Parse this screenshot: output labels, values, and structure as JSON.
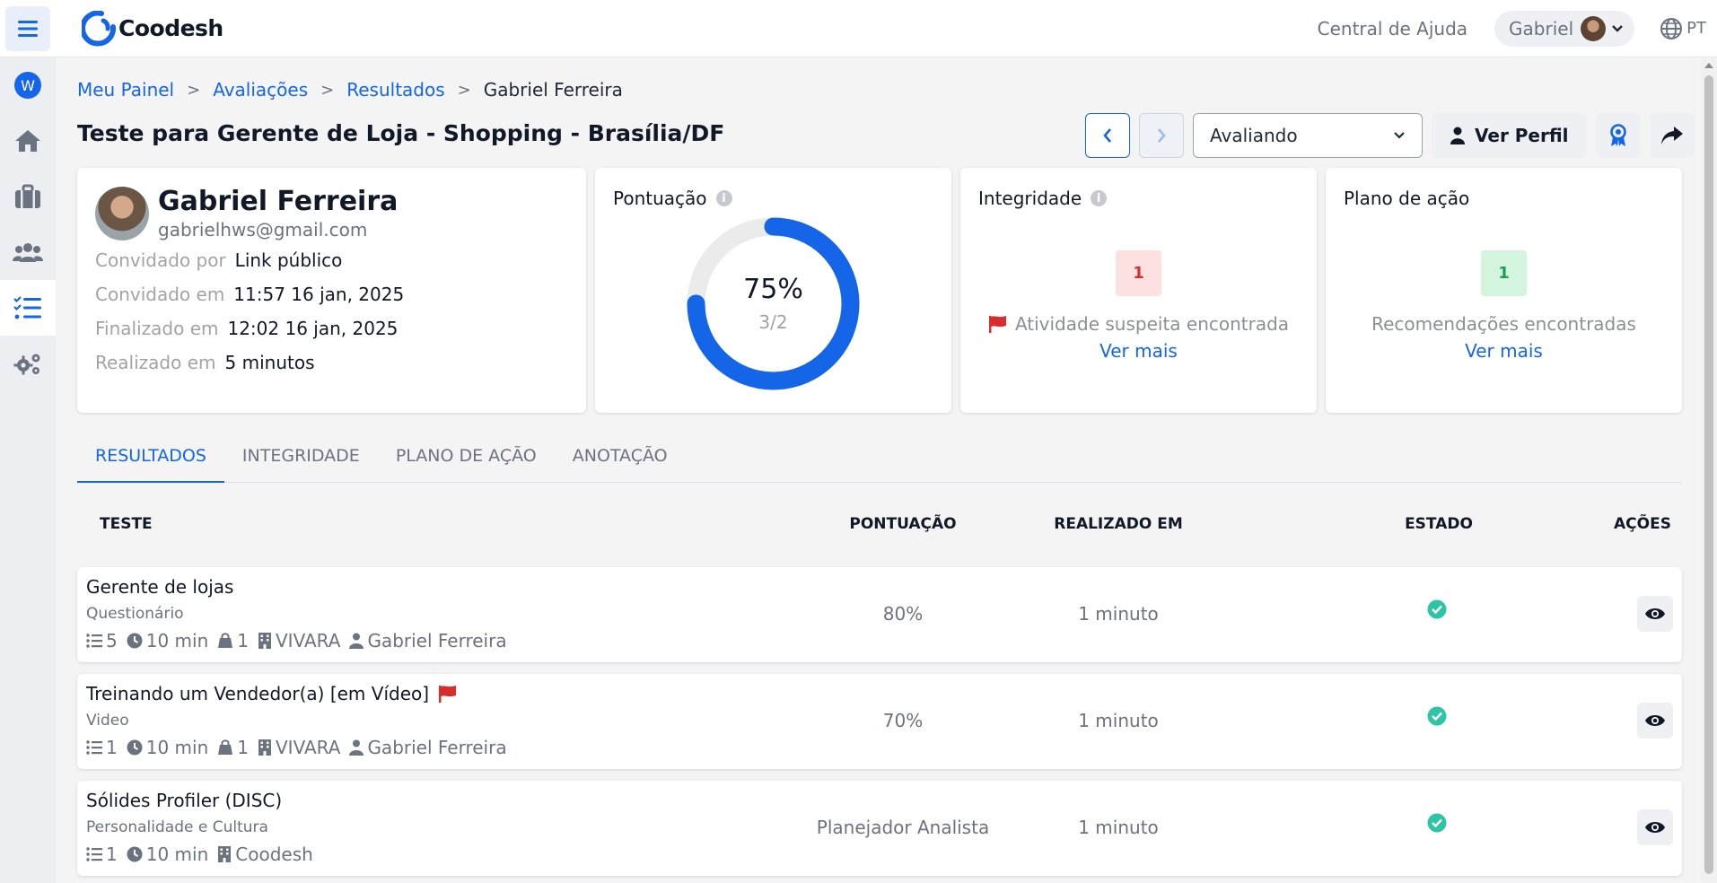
{
  "app": {
    "name": "Coodesh",
    "help_label": "Central de Ajuda",
    "user_name": "Gabriel",
    "lang": "PT",
    "workspace_initial": "W"
  },
  "breadcrumb": {
    "items": [
      "Meu Painel",
      "Avaliações",
      "Resultados"
    ],
    "current": "Gabriel Ferreira"
  },
  "page": {
    "title": "Teste para Gerente de Loja - Shopping - Brasília/DF"
  },
  "actions": {
    "status_value": "Avaliando",
    "profile_label": "Ver Perfil"
  },
  "candidate": {
    "name": "Gabriel Ferreira",
    "email": "gabrielhws@gmail.com",
    "rows": [
      {
        "label": "Convidado por",
        "value": "Link público"
      },
      {
        "label": "Convidado em",
        "value": "11:57 16 jan, 2025"
      },
      {
        "label": "Finalizado em",
        "value": "12:02 16 jan, 2025"
      },
      {
        "label": "Realizado em",
        "value": "5 minutos"
      }
    ]
  },
  "score": {
    "title": "Pontuação",
    "percent_label": "75%",
    "fraction": "3/2",
    "percent": 75,
    "color": "#1565e8"
  },
  "integrity": {
    "title": "Integridade",
    "count": "1",
    "message": "Atividade suspeita encontrada",
    "link": "Ver mais"
  },
  "plan": {
    "title": "Plano de ação",
    "count": "1",
    "message": "Recomendações encontradas",
    "link": "Ver mais"
  },
  "tabs": [
    "RESULTADOS",
    "INTEGRIDADE",
    "PLANO DE AÇÃO",
    "ANOTAÇÃO"
  ],
  "table": {
    "headers": {
      "test": "TESTE",
      "score": "PONTUAÇÃO",
      "time": "REALIZADO EM",
      "state": "ESTADO",
      "actions": "AÇÕES"
    },
    "rows": [
      {
        "title": "Gerente de lojas",
        "type": "Questionário",
        "questions": "5",
        "duration": "10 min",
        "jobs": "1",
        "company": "VIVARA",
        "author": "Gabriel Ferreira",
        "score": "80%",
        "time": "1 minuto",
        "flagged": false
      },
      {
        "title": "Treinando um Vendedor(a) [em Vídeo]",
        "type": "Video",
        "questions": "1",
        "duration": "10 min",
        "jobs": "1",
        "company": "VIVARA",
        "author": "Gabriel Ferreira",
        "score": "70%",
        "time": "1 minuto",
        "flagged": true
      },
      {
        "title": "Sólides Profiler (DISC)",
        "type": "Personalidade e Cultura",
        "questions": "1",
        "duration": "10 min",
        "company": "Coodesh",
        "score": "Planejador Analista",
        "time": "1 minuto",
        "flagged": false
      }
    ]
  },
  "colors": {
    "accent": "#1565e8",
    "success": "#2ec4a6",
    "danger": "#d92d2d"
  }
}
